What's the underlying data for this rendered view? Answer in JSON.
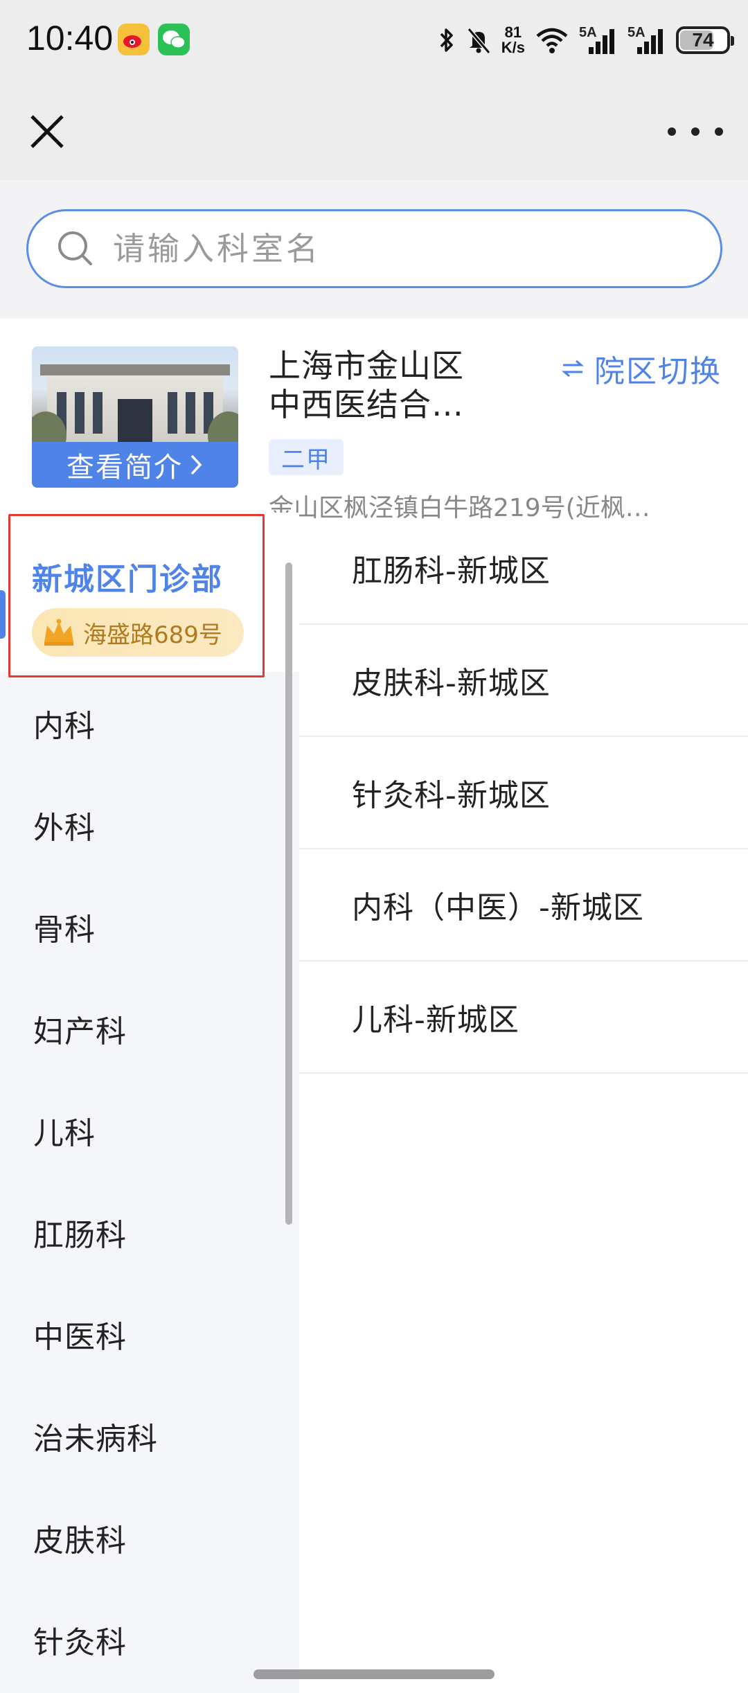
{
  "status_bar": {
    "time": "10:40",
    "net_speed_value": "81",
    "net_speed_unit": "K/s",
    "signal1_label": "5A",
    "signal2_label": "5A",
    "battery": "74",
    "battery_level": 0.74,
    "icons": [
      "weibo-icon",
      "wechat-icon",
      "bluetooth-icon",
      "mute-icon",
      "wifi-icon",
      "signal-icon",
      "signal-icon",
      "battery-icon"
    ]
  },
  "title_bar": {
    "close_icon": "close-icon",
    "more_icon": "more-icon"
  },
  "search": {
    "placeholder": "请输入科室名"
  },
  "hospital": {
    "name_line1": "上海市金山区",
    "name_line2": "中西医结合…",
    "view_intro_label": "查看简介",
    "switch_label": "院区切换",
    "grade": "二甲",
    "address": "金山区枫泾镇白牛路219号(近枫…"
  },
  "campus": {
    "name": "新城区门诊部",
    "location": "海盛路689号"
  },
  "departments": [
    {
      "label": "内科"
    },
    {
      "label": "外科"
    },
    {
      "label": "骨科"
    },
    {
      "label": "妇产科"
    },
    {
      "label": "儿科"
    },
    {
      "label": "肛肠科"
    },
    {
      "label": "中医科"
    },
    {
      "label": "治未病科"
    },
    {
      "label": "皮肤科"
    },
    {
      "label": "针灸科"
    }
  ],
  "sub_departments": [
    {
      "label": "肛肠科-新城区"
    },
    {
      "label": "皮肤科-新城区"
    },
    {
      "label": "针灸科-新城区"
    },
    {
      "label": "内科（中医）-新城区"
    },
    {
      "label": "儿科-新城区"
    }
  ],
  "colors": {
    "accent": "#4f83e8",
    "highlight_border": "#e53935",
    "chip_text": "#b07a1e"
  }
}
